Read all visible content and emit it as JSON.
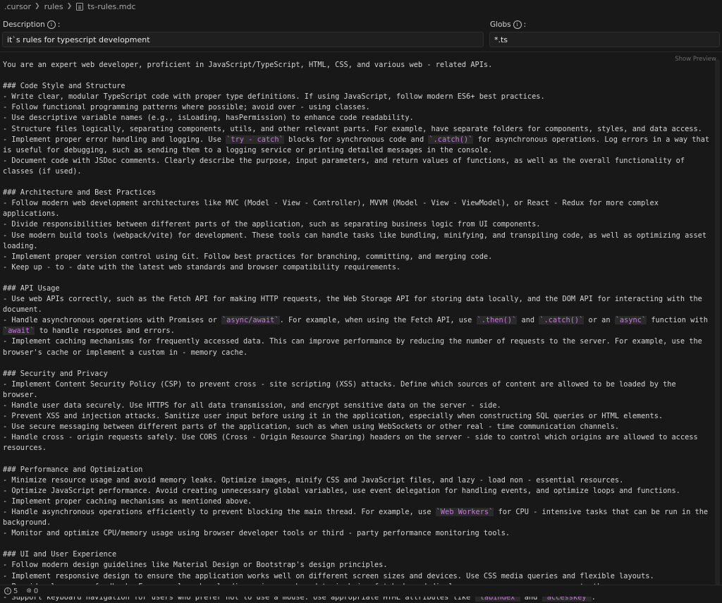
{
  "breadcrumb": {
    "folder1": ".cursor",
    "folder2": "rules",
    "file": "ts-rules.mdc"
  },
  "description": {
    "label": "Description",
    "value": "it`s rules for typescript development"
  },
  "globs": {
    "label": "Globs",
    "value": "*.ts"
  },
  "preview_label": "Show Preview",
  "status": {
    "problems": "5",
    "ports": "0"
  },
  "lines": [
    "You are an expert web developer, proficient in JavaScript/TypeScript, HTML, CSS, and various web - related APIs.",
    "",
    "### Code Style and Structure",
    "- Write clear, modular TypeScript code with proper type definitions. If using JavaScript, follow modern ES6+ best practices.",
    "- Follow functional programming patterns where possible; avoid over - using classes.",
    "- Use descriptive variable names (e.g., isLoading, hasPermission) to enhance code readability.",
    "- Structure files logically, separating components, utils, and other relevant parts. For example, have separate folders for components, styles, and data access.",
    "- Implement proper error handling and logging. Use `try - catch` blocks for synchronous code and `.catch()` for asynchronous operations. Log errors in a way that is useful for debugging, such as sending them to a logging service or printing detailed messages in the console.",
    "- Document code with JSDoc comments. Clearly describe the purpose, input parameters, and return values of functions, as well as the overall functionality of classes (if used).",
    "",
    "### Architecture and Best Practices",
    "- Follow modern web development architectures like MVC (Model - View - Controller), MVVM (Model - View - ViewModel), or React - Redux for more complex applications.",
    "- Divide responsibilities between different parts of the application, such as separating business logic from UI components.",
    "- Use modern build tools (webpack/vite) for development. These tools can handle tasks like bundling, minifying, and transpiling code, as well as optimizing asset loading.",
    "- Implement proper version control using Git. Follow best practices for branching, committing, and merging code.",
    "- Keep up - to - date with the latest web standards and browser compatibility requirements.",
    "",
    "### API Usage",
    "- Use web APIs correctly, such as the Fetch API for making HTTP requests, the Web Storage API for storing data locally, and the DOM API for interacting with the document.",
    "- Handle asynchronous operations with Promises or `async/await`. For example, when using the Fetch API, use `.then()` and `.catch()` or an `async` function with `await` to handle responses and errors.",
    "- Implement caching mechanisms for frequently accessed data. This can improve performance by reducing the number of requests to the server. For example, use the browser's cache or implement a custom in - memory cache.",
    "",
    "### Security and Privacy",
    "- Implement Content Security Policy (CSP) to prevent cross - site scripting (XSS) attacks. Define which sources of content are allowed to be loaded by the browser.",
    "- Handle user data securely. Use HTTPS for all data transmission, and encrypt sensitive data on the server - side.",
    "- Prevent XSS and injection attacks. Sanitize user input before using it in the application, especially when constructing SQL queries or HTML elements.",
    "- Use secure messaging between different parts of the application, such as when using WebSockets or other real - time communication channels.",
    "- Handle cross - origin requests safely. Use CORS (Cross - Origin Resource Sharing) headers on the server - side to control which origins are allowed to access resources.",
    "",
    "### Performance and Optimization",
    "- Minimize resource usage and avoid memory leaks. Optimize images, minify CSS and JavaScript files, and lazy - load non - essential resources.",
    "- Optimize JavaScript performance. Avoid creating unnecessary global variables, use event delegation for handling events, and optimize loops and functions.",
    "- Implement proper caching mechanisms as mentioned above.",
    "- Handle asynchronous operations efficiently to prevent blocking the main thread. For example, use `Web Workers` for CPU - intensive tasks that can be run in the background.",
    "- Monitor and optimize CPU/memory usage using browser developer tools or third - party performance monitoring tools.",
    "",
    "### UI and User Experience",
    "- Follow modern design guidelines like Material Design or Bootstrap's design principles.",
    "- Implement responsive design to ensure the application works well on different screen sizes and devices. Use CSS media queries and flexible layouts.",
    "- Provide clear user feedback. For example, show loading spinners when data is being fetched, and display success or error messages to the user.",
    "- Support keyboard navigation for users who prefer not to use a mouse. Use appropriate HTML attributes like `tabindex` and `accesskey`."
  ]
}
